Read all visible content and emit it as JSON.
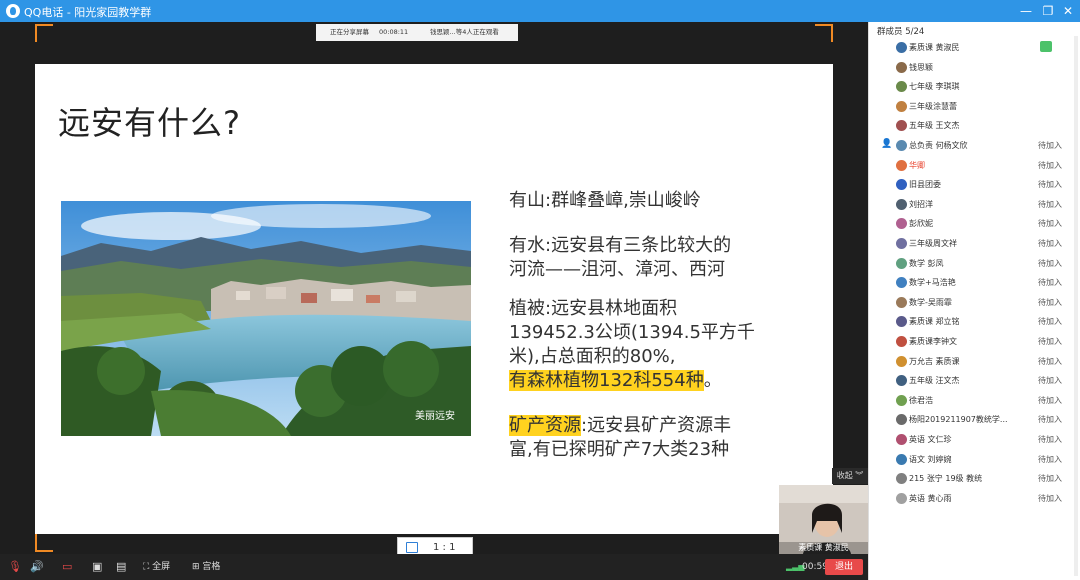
{
  "window": {
    "title": "QQ电话 - 阳光家园教学群"
  },
  "share_bar": {
    "status": "正在分享屏幕",
    "timer": "00:08:11",
    "viewers": "钱思颖...等4人正在观看"
  },
  "slide": {
    "title": "远安有什么?",
    "photo_watermark": "美丽远安",
    "paragraphs": {
      "p1": "有山:群峰叠嶂,崇山峻岭",
      "p2a": "有水:远安县有三条比较大的",
      "p2b": "河流——沮河、漳河、西河",
      "p3a": "植被:远安县林地面积",
      "p3b": "139452.3公顷(1394.5平方千",
      "p3c": "米),占总面积的80%,",
      "p3d": "有森林植物132科554种",
      "p3e": "。",
      "p4a": "矿产资源",
      "p4b": ":远安县矿产资源丰",
      "p4c": "富,有已探明矿产7大类23种"
    }
  },
  "ratio": "1 : 1",
  "collapse_label": "收起",
  "camera": {
    "label": "素质课 黄淑民"
  },
  "toolbar": {
    "fullscreen": "全屏",
    "gallery": "宫格",
    "time": "00:59",
    "end": "退出"
  },
  "panel": {
    "header": "群成员 5/24",
    "members": [
      {
        "name": "素质课 黄淑民",
        "status": "",
        "avatar": "#3a6ea5",
        "mic": true,
        "owner": false
      },
      {
        "name": "钱思颖",
        "status": "",
        "avatar": "#8a6a4a",
        "mic": false,
        "owner": false
      },
      {
        "name": "七年级 李琪琪",
        "status": "",
        "avatar": "#6a8a4a",
        "mic": false,
        "owner": false
      },
      {
        "name": "三年级涂慧蕾",
        "status": "",
        "avatar": "#c08040",
        "mic": false,
        "owner": false
      },
      {
        "name": "五年级 王文杰",
        "status": "",
        "avatar": "#a05050",
        "mic": false,
        "owner": false
      },
      {
        "name": "总负责 何杨文欣",
        "status": "待加入",
        "avatar": "#5a8ab0",
        "mic": false,
        "owner": true
      },
      {
        "name": "华卿",
        "status": "待加入",
        "avatar": "#e07040",
        "mic": false,
        "owner": false
      },
      {
        "name": "旧县团委",
        "status": "待加入",
        "avatar": "#3060c0",
        "mic": false,
        "owner": false
      },
      {
        "name": "刘招洋",
        "status": "待加入",
        "avatar": "#506070",
        "mic": false,
        "owner": false
      },
      {
        "name": "彭欣妮",
        "status": "待加入",
        "avatar": "#b06090",
        "mic": false,
        "owner": false
      },
      {
        "name": "三年级周文祥",
        "status": "待加入",
        "avatar": "#7070a0",
        "mic": false,
        "owner": false
      },
      {
        "name": "数学 彭凤",
        "status": "待加入",
        "avatar": "#60a080",
        "mic": false,
        "owner": false
      },
      {
        "name": "数学+马浩艳",
        "status": "待加入",
        "avatar": "#4080c0",
        "mic": false,
        "owner": false
      },
      {
        "name": "数学-吴雨霏",
        "status": "待加入",
        "avatar": "#9a7a5a",
        "mic": false,
        "owner": false
      },
      {
        "name": "素质课 郑立铭",
        "status": "待加入",
        "avatar": "#5a5a8a",
        "mic": false,
        "owner": false
      },
      {
        "name": "素质课李钟文",
        "status": "待加入",
        "avatar": "#c05040",
        "mic": false,
        "owner": false
      },
      {
        "name": "万允吉 素质课",
        "status": "待加入",
        "avatar": "#d09030",
        "mic": false,
        "owner": false
      },
      {
        "name": "五年级 汪文杰",
        "status": "待加入",
        "avatar": "#406080",
        "mic": false,
        "owner": false
      },
      {
        "name": "徐君浩",
        "status": "待加入",
        "avatar": "#70a050",
        "mic": false,
        "owner": false
      },
      {
        "name": "杨阳2019211907教统学...",
        "status": "待加入",
        "avatar": "#6a6a6a",
        "mic": false,
        "owner": false
      },
      {
        "name": "英语 文仁珍",
        "status": "待加入",
        "avatar": "#b05070",
        "mic": false,
        "owner": false
      },
      {
        "name": "语文 刘婷婉",
        "status": "待加入",
        "avatar": "#3a7ab0",
        "mic": false,
        "owner": false
      },
      {
        "name": "215 张宁 19级 教统",
        "status": "待加入",
        "avatar": "#808080",
        "mic": false,
        "owner": false
      },
      {
        "name": "英语 黄心雨",
        "status": "待加入",
        "avatar": "#a0a0a0",
        "mic": false,
        "owner": false
      }
    ]
  }
}
